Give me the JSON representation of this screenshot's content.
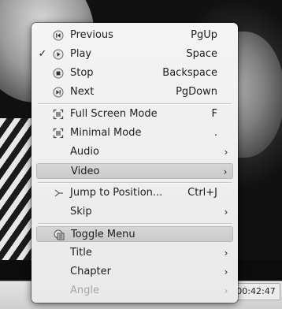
{
  "window": {
    "time_display": "00:42:47"
  },
  "menu": {
    "items": [
      {
        "id": "previous",
        "label": "Previous",
        "shortcut": "PgUp",
        "icon": "previous-icon"
      },
      {
        "id": "play",
        "label": "Play",
        "shortcut": "Space",
        "icon": "play-icon",
        "checked": true
      },
      {
        "id": "stop",
        "label": "Stop",
        "shortcut": "Backspace",
        "icon": "stop-icon"
      },
      {
        "id": "next",
        "label": "Next",
        "shortcut": "PgDown",
        "icon": "next-icon"
      },
      {
        "id": "full-screen",
        "label": "Full Screen Mode",
        "shortcut": "F",
        "icon": "fullscreen-icon"
      },
      {
        "id": "minimal-mode",
        "label": "Minimal Mode",
        "shortcut": ".",
        "icon": "minimal-mode-icon"
      },
      {
        "id": "audio",
        "label": "Audio",
        "submenu": true
      },
      {
        "id": "video",
        "label": "Video",
        "submenu": true,
        "highlighted": true
      },
      {
        "id": "jump",
        "label": "Jump to Position...",
        "shortcut": "Ctrl+J",
        "icon": "jump-icon"
      },
      {
        "id": "skip",
        "label": "Skip",
        "submenu": true
      },
      {
        "id": "toggle-menu",
        "label": "Toggle Menu",
        "icon": "toggle-menu-icon",
        "highlighted": true
      },
      {
        "id": "title",
        "label": "Title",
        "submenu": true
      },
      {
        "id": "chapter",
        "label": "Chapter",
        "submenu": true
      },
      {
        "id": "angle",
        "label": "Angle",
        "submenu": true,
        "disabled": true
      }
    ],
    "check_glyph": "✓",
    "submenu_glyph": "›"
  }
}
